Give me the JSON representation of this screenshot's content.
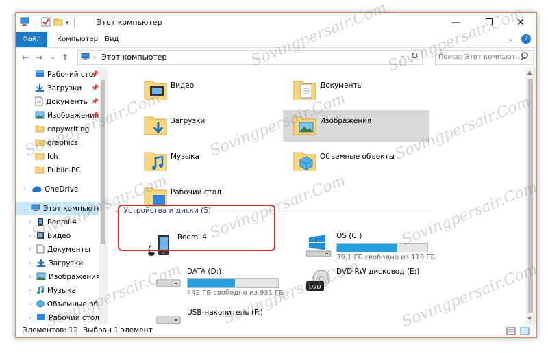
{
  "window": {
    "title": "Этот компьютер"
  },
  "ribbon": {
    "tabs": [
      "Файл",
      "Компьютер",
      "Вид"
    ]
  },
  "address": {
    "path": "Этот компьютер",
    "search_placeholder": "Поиск: Этот компьют..."
  },
  "nav": {
    "items": [
      {
        "label": "Рабочий стол",
        "icon": "desktop-icon",
        "pinned": true
      },
      {
        "label": "Загрузки",
        "icon": "downloads-icon",
        "pinned": true
      },
      {
        "label": "Документы",
        "icon": "documents-icon",
        "pinned": true
      },
      {
        "label": "Изображения",
        "icon": "pictures-icon",
        "pinned": true
      },
      {
        "label": "copywriting",
        "icon": "folder-icon"
      },
      {
        "label": "graphics",
        "icon": "folder-icon"
      },
      {
        "label": "Ich",
        "icon": "folder-icon"
      },
      {
        "label": "Public-PC",
        "icon": "folder-icon"
      },
      {
        "label": "OneDrive",
        "icon": "onedrive-icon"
      },
      {
        "label": "Этот компьютер",
        "icon": "computer-icon"
      },
      {
        "label": "Redmi 4",
        "icon": "phone-icon"
      },
      {
        "label": "Видео",
        "icon": "video-icon"
      },
      {
        "label": "Документы",
        "icon": "documents-icon"
      },
      {
        "label": "Загрузки",
        "icon": "downloads-icon"
      },
      {
        "label": "Изображения",
        "icon": "pictures-icon"
      },
      {
        "label": "Музыка",
        "icon": "music-icon"
      },
      {
        "label": "Объемные объе",
        "icon": "3d-icon"
      },
      {
        "label": "Рабочий стол",
        "icon": "desktop-icon"
      }
    ]
  },
  "folders": [
    {
      "label": "Видео",
      "icon": "video-folder-icon"
    },
    {
      "label": "Документы",
      "icon": "documents-folder-icon"
    },
    {
      "label": "Загрузки",
      "icon": "downloads-folder-icon"
    },
    {
      "label": "Изображения",
      "icon": "pictures-folder-icon"
    },
    {
      "label": "Музыка",
      "icon": "music-folder-icon"
    },
    {
      "label": "Объемные объекты",
      "icon": "3d-folder-icon"
    },
    {
      "label": "Рабочий стол",
      "icon": "desktop-folder-icon"
    }
  ],
  "devices": {
    "header": "Устройства и диски (5)",
    "items": [
      {
        "label": "Redmi 4",
        "icon": "phone-device-icon"
      },
      {
        "label": "OS (C:)",
        "free": "39,1 ГБ свободно из 118 ГБ",
        "used_fraction": 0.67,
        "icon": "windows-drive-icon"
      },
      {
        "label": "DATA (D:)",
        "free": "442 ГБ свободно из 931 ГБ",
        "used_fraction": 0.52,
        "icon": "hdd-icon"
      },
      {
        "label": "DVD RW дисковод (E:)",
        "icon": "dvd-drive-icon"
      },
      {
        "label": "USB-накопитель (F:)",
        "icon": "usb-drive-icon"
      }
    ]
  },
  "status": {
    "count": "Элементов: 12",
    "selected": "Выбран 1 элемент"
  },
  "watermark": "Sovingpersair.Com",
  "colors": {
    "accent": "#1979ca",
    "selection": "#cce8ff",
    "bar_fill": "#26a0da",
    "highlight": "#d9282a",
    "group_header": "#1e3287"
  }
}
